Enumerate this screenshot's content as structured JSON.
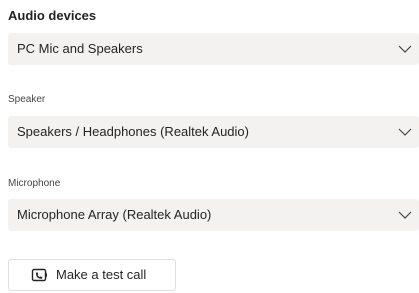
{
  "settings": {
    "title": "Audio devices",
    "device_dropdown": {
      "value": "PC Mic and Speakers"
    },
    "speaker": {
      "label": "Speaker",
      "value": "Speakers / Headphones (Realtek Audio)"
    },
    "microphone": {
      "label": "Microphone",
      "value": "Microphone Array (Realtek Audio)"
    },
    "test_call_button": {
      "label": "Make a test call",
      "icon": "call-test-icon"
    }
  },
  "colors": {
    "dropdown_bg": "#f3f2f1",
    "text": "#252423",
    "label": "#484644",
    "border": "#e1dfdd"
  }
}
